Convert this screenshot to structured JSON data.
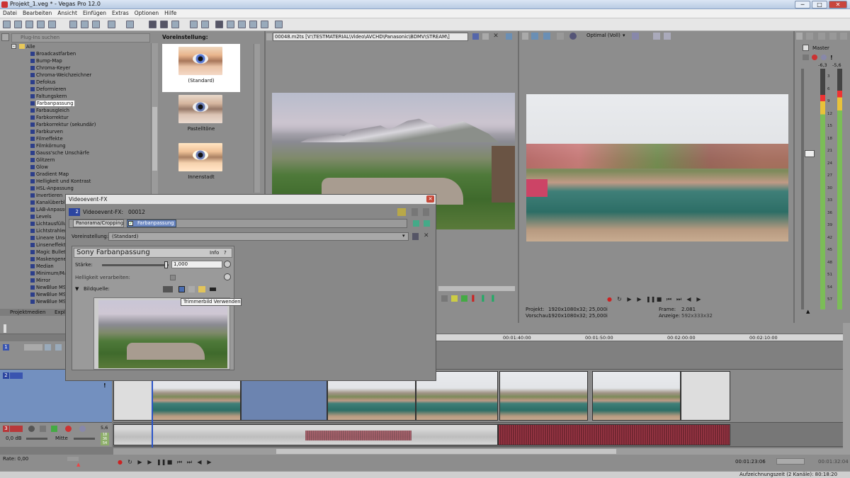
{
  "window": {
    "title": "Projekt_1.veg * - Vegas Pro 12.0",
    "min": "─",
    "max": "□",
    "close": "✕"
  },
  "menu": [
    "Datei",
    "Bearbeiten",
    "Ansicht",
    "Einfügen",
    "Extras",
    "Optionen",
    "Hilfe"
  ],
  "plugin_panel": {
    "search_placeholder": "Plug-Ins suchen",
    "root": "Alle",
    "items": [
      "Broadcastfarben",
      "Bump-Map",
      "Chroma-Keyer",
      "Chroma-Weichzeichner",
      "Defokus",
      "Deformieren",
      "Faltungskern",
      "Farbanpassung",
      "Farbausgleich",
      "Farbkorrektur",
      "Farbkorrektur (sekundär)",
      "Farbkurven",
      "Filmeffekte",
      "Filmkörnung",
      "Gauss'sche Unschärfe",
      "Glitzern",
      "Glow",
      "Gradient Map",
      "Helligkeit und Kontrast",
      "HSL-Anpassung",
      "Invertieren",
      "Kanalüberblendung",
      "LAB-Anpassung",
      "Levels",
      "Lichtausfüllung",
      "Lichtstrahlen",
      "Lineare Unschärfe",
      "Linseneffekt",
      "Magic Bullet Quick",
      "Maskengenerator",
      "Median",
      "Minimum/Maximum",
      "Mirror",
      "NewBlue MSP",
      "NewBlue MSP",
      "NewBlue MSP"
    ],
    "selected": "Farbanpassung",
    "tabs": [
      "Projektmedien",
      "Explorer"
    ]
  },
  "presets": {
    "header": "Voreinstellung:",
    "items": [
      "(Standard)",
      "Pastelltöne",
      "Innenstadt"
    ]
  },
  "trimmer": {
    "path": "00048.m2ts    [V:\\TESTMATERIAL\\Video\\AVCHD\\Panasonic\\BDMV\\STREAM\\]"
  },
  "preview": {
    "quality": "Optimal (Voll)",
    "projekt_label": "Projekt:",
    "projekt_value": "1920x1080x32; 25,000i",
    "vorschau_label": "Vorschau:",
    "vorschau_value": "1920x1080x32; 25,000i",
    "frame_label": "Frame:",
    "frame_value": "2.081",
    "anzeige_label": "Anzeige:",
    "anzeige_value": "592x333x32"
  },
  "master": {
    "label": "Master",
    "left_db": "-6,3",
    "right_db": "-5,6",
    "scale": [
      "3",
      "6",
      "9",
      "12",
      "15",
      "18",
      "21",
      "24",
      "27",
      "30",
      "33",
      "36",
      "39",
      "42",
      "45",
      "48",
      "51",
      "54",
      "57"
    ],
    "left_level": 0.89,
    "right_level": 0.91
  },
  "fx_dialog": {
    "title": "Videoevent-FX",
    "event_label": "Videoevent-FX:",
    "event_id": "00012",
    "badge": "2",
    "chain": [
      "Panorama/Cropping",
      "Farbanpassung"
    ],
    "preset_label": "Voreinstellung:",
    "preset_value": "(Standard)",
    "plugin_title": "Sony Farbanpassung",
    "info": "Info",
    "help": "?",
    "staerke_label": "Stärke:",
    "staerke_value": "1,000",
    "staerke_level": 0.98,
    "helligkeit_label": "Helligkeit verarbeiten:",
    "bildquelle_label": "Bildquelle:",
    "tooltip": "Trimmerbild Verwenden"
  },
  "timeline": {
    "ruler": [
      "00:01:40:00",
      "00:01:50:00",
      "00:02:00:00",
      "00:02:10:00"
    ],
    "track1_num": "1",
    "track2_num": "2",
    "track3_num": "3",
    "vol_db": "0,0 dB",
    "pan": "Mitte",
    "audio_meter": [
      "18",
      "36",
      "54"
    ],
    "scale_left": "5,6"
  },
  "transport": {
    "rate": "Rate: 0,00",
    "time": "00:01:23:06",
    "end_time": "00:01:32:04"
  },
  "status": {
    "text": "Aufzeichnungszeit (2 Kanäle): 80:18:20"
  }
}
